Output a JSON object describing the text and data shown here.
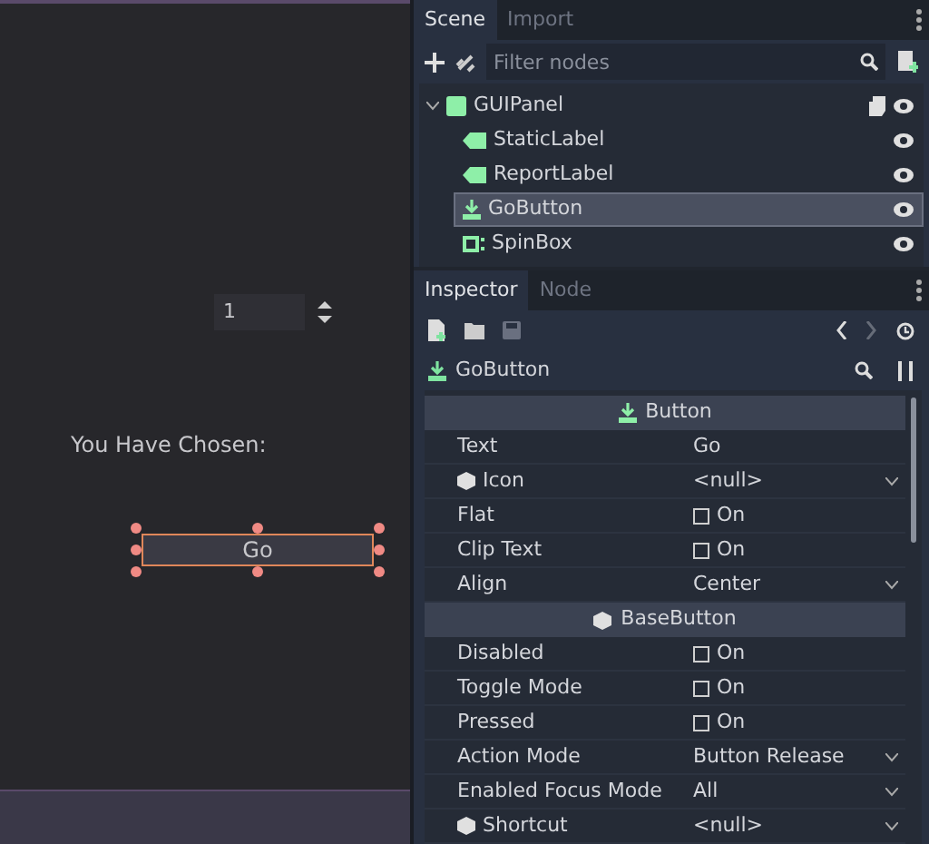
{
  "viewport": {
    "spinbox": {
      "value": "1"
    },
    "label": "You Have Chosen:",
    "button": {
      "text": "Go",
      "selected": true
    }
  },
  "scene_dock": {
    "tabs": [
      {
        "label": "Scene",
        "selected": true
      },
      {
        "label": "Import",
        "selected": false
      }
    ],
    "filter": {
      "placeholder": "Filter nodes"
    },
    "tree": [
      {
        "name": "GUIPanel",
        "kind": "panel",
        "script": true,
        "expanded": true,
        "selected": false,
        "children": [
          {
            "name": "StaticLabel",
            "kind": "label",
            "selected": false
          },
          {
            "name": "ReportLabel",
            "kind": "label",
            "selected": false
          },
          {
            "name": "GoButton",
            "kind": "button",
            "selected": true
          },
          {
            "name": "SpinBox",
            "kind": "spinbox",
            "selected": false
          }
        ]
      }
    ]
  },
  "inspector": {
    "tabs": [
      {
        "label": "Inspector",
        "selected": true
      },
      {
        "label": "Node",
        "selected": false
      }
    ],
    "node": "GoButton",
    "sections": [
      {
        "title": "Button",
        "kind": "button",
        "properties": [
          {
            "name": "Text",
            "kind": "text",
            "value": "Go"
          },
          {
            "name": "Icon",
            "kind": "resource",
            "value": "<null>"
          },
          {
            "name": "Flat",
            "kind": "check",
            "checked": false,
            "value": "On"
          },
          {
            "name": "Clip Text",
            "kind": "check",
            "checked": false,
            "value": "On"
          },
          {
            "name": "Align",
            "kind": "enum",
            "value": "Center"
          }
        ]
      },
      {
        "title": "BaseButton",
        "kind": "object",
        "properties": [
          {
            "name": "Disabled",
            "kind": "check",
            "checked": false,
            "value": "On"
          },
          {
            "name": "Toggle Mode",
            "kind": "check",
            "checked": false,
            "value": "On"
          },
          {
            "name": "Pressed",
            "kind": "check",
            "checked": false,
            "value": "On"
          },
          {
            "name": "Action Mode",
            "kind": "enum",
            "value": "Button Release"
          },
          {
            "name": "Enabled Focus Mode",
            "kind": "enum",
            "value": "All"
          },
          {
            "name": "Shortcut",
            "kind": "resource",
            "value": "<null>"
          }
        ]
      }
    ]
  }
}
